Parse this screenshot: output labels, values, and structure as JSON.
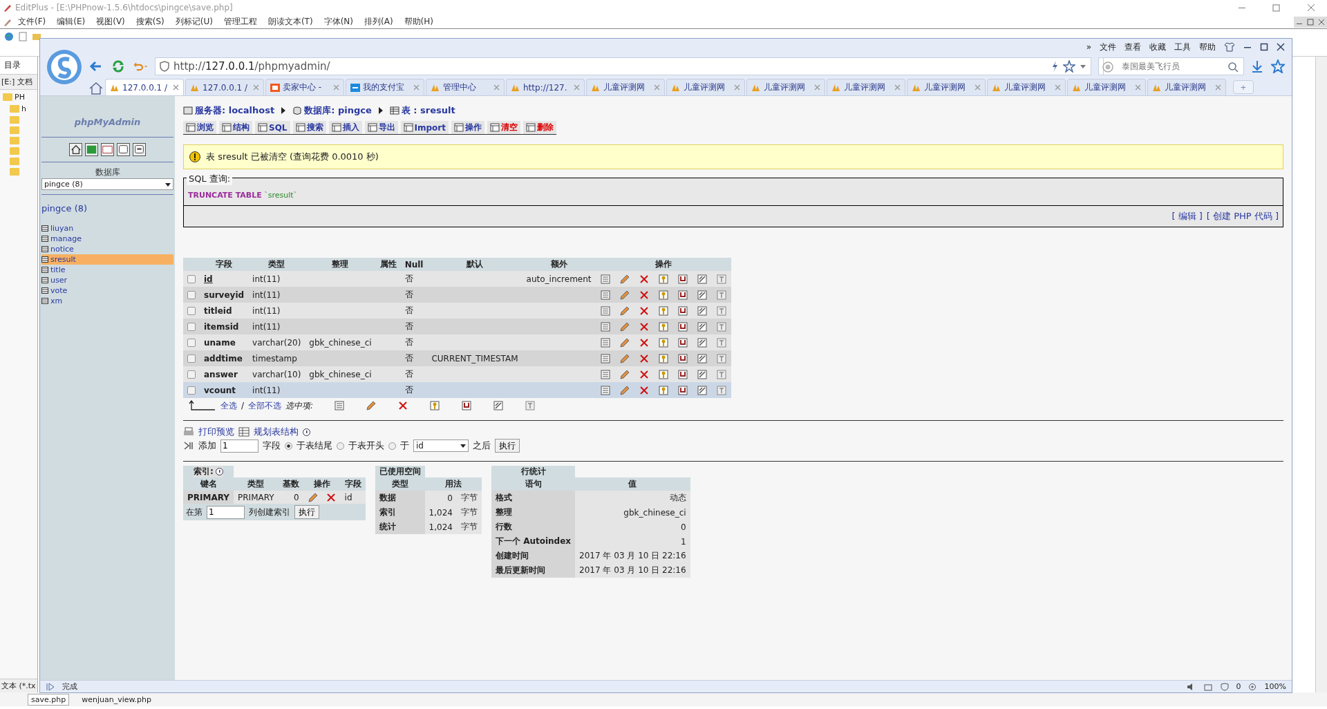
{
  "editor": {
    "title": "EditPlus - [E:\\PHPnow-1.5.6\\htdocs\\pingce\\save.php]",
    "menu": [
      "文件(F)",
      "编辑(E)",
      "视图(V)",
      "搜索(S)",
      "列标记(U)",
      "管理工程",
      "朗读文本(T)",
      "字体(N)",
      "排列(A)",
      "帮助(H)"
    ],
    "sidebar_tab": "目录",
    "drive": "[E:] 文档",
    "folders": [
      "PH",
      "h"
    ],
    "filter": "文本 (*.tx",
    "files": [
      {
        "name": "save.php",
        "selected": true
      },
      {
        "name": "wenjuan_view.php",
        "selected": false
      }
    ]
  },
  "browser": {
    "menu": [
      "»",
      "文件",
      "查看",
      "收藏",
      "工具",
      "帮助"
    ],
    "url": {
      "scheme": "http://",
      "host": "127.0.0.1",
      "path": "/phpmyadmin/"
    },
    "search": {
      "placeholder": "泰国最美飞行员"
    },
    "tabs": [
      {
        "label": "127.0.0.1 /",
        "kind": "pma",
        "selected": true
      },
      {
        "label": "127.0.0.1 /",
        "kind": "pma",
        "selected": false
      },
      {
        "label": "卖家中心 -",
        "kind": "shop",
        "selected": false
      },
      {
        "label": "我的支付宝",
        "kind": "pay",
        "selected": false
      },
      {
        "label": "管理中心",
        "kind": "pma",
        "selected": false
      },
      {
        "label": "http://127.",
        "kind": "pma",
        "selected": false
      },
      {
        "label": "儿童评测网",
        "kind": "pma",
        "selected": false
      },
      {
        "label": "儿童评测网",
        "kind": "pma",
        "selected": false
      },
      {
        "label": "儿童评测网",
        "kind": "pma",
        "selected": false
      },
      {
        "label": "儿童评测网",
        "kind": "pma",
        "selected": false
      },
      {
        "label": "儿童评测网",
        "kind": "pma",
        "selected": false
      },
      {
        "label": "儿童评测网",
        "kind": "pma",
        "selected": false
      },
      {
        "label": "儿童评测网",
        "kind": "pma",
        "selected": false
      },
      {
        "label": "儿童评测网",
        "kind": "pma",
        "selected": false
      }
    ],
    "new_tab": "+",
    "status": "完成",
    "blocked": "0",
    "zoom": "100%"
  },
  "sidebar": {
    "logo": "phpMyAdmin",
    "db_label": "数据库",
    "db_select": "pingce (8)",
    "db_link": "pingce (8)",
    "tables": [
      {
        "name": "liuyan",
        "selected": false
      },
      {
        "name": "manage",
        "selected": false
      },
      {
        "name": "notice",
        "selected": false
      },
      {
        "name": "sresult",
        "selected": true
      },
      {
        "name": "title",
        "selected": false
      },
      {
        "name": "user",
        "selected": false
      },
      {
        "name": "vote",
        "selected": false
      },
      {
        "name": "xm",
        "selected": false
      }
    ]
  },
  "breadcrumb": [
    "服务器: localhost",
    "数据库: pingce",
    "表 : sresult"
  ],
  "tabs": [
    {
      "label": "浏览",
      "kind": "normal"
    },
    {
      "label": "结构",
      "kind": "normal"
    },
    {
      "label": "SQL",
      "kind": "normal"
    },
    {
      "label": "搜索",
      "kind": "normal"
    },
    {
      "label": "插入",
      "kind": "normal"
    },
    {
      "label": "导出",
      "kind": "normal"
    },
    {
      "label": "Import",
      "kind": "normal"
    },
    {
      "label": "操作",
      "kind": "normal"
    },
    {
      "label": "清空",
      "kind": "danger"
    },
    {
      "label": "删除",
      "kind": "danger"
    }
  ],
  "message": "表 sresult 已被清空 (查询花费 0.0010 秒)",
  "sql": {
    "legend": "SQL 查询:",
    "keyword": "TRUNCATE TABLE",
    "name": "`sresult`",
    "links": [
      "[ 编辑 ]",
      "[ 创建 PHP 代码 ]"
    ]
  },
  "structure": {
    "columns": [
      "字段",
      "类型",
      "整理",
      "属性",
      "Null",
      "默认",
      "额外",
      "操作"
    ],
    "rows": [
      {
        "field": "id",
        "type": "int(11)",
        "collation": "",
        "null": "否",
        "default": "",
        "extra": "auto_increment",
        "primary": true,
        "hovered": false
      },
      {
        "field": "surveyid",
        "type": "int(11)",
        "collation": "",
        "null": "否",
        "default": "",
        "extra": "",
        "primary": false,
        "hovered": false
      },
      {
        "field": "titleid",
        "type": "int(11)",
        "collation": "",
        "null": "否",
        "default": "",
        "extra": "",
        "primary": false,
        "hovered": false
      },
      {
        "field": "itemsid",
        "type": "int(11)",
        "collation": "",
        "null": "否",
        "default": "",
        "extra": "",
        "primary": false,
        "hovered": false
      },
      {
        "field": "uname",
        "type": "varchar(20)",
        "collation": "gbk_chinese_ci",
        "null": "否",
        "default": "",
        "extra": "",
        "primary": false,
        "hovered": false
      },
      {
        "field": "addtime",
        "type": "timestamp",
        "collation": "",
        "null": "否",
        "default": "CURRENT_TIMESTAM",
        "extra": "",
        "primary": false,
        "hovered": false
      },
      {
        "field": "answer",
        "type": "varchar(10)",
        "collation": "gbk_chinese_ci",
        "null": "否",
        "default": "",
        "extra": "",
        "primary": false,
        "hovered": false
      },
      {
        "field": "vcount",
        "type": "int(11)",
        "collation": "",
        "null": "否",
        "default": "",
        "extra": "",
        "primary": false,
        "hovered": true
      }
    ],
    "check_all": "全选",
    "separator": "/",
    "uncheck_all": "全部不选",
    "with_selected": "选中项:"
  },
  "tools": {
    "print": "打印预览",
    "plan": "规划表结构",
    "add": "添加",
    "count": "1",
    "fields": "字段",
    "positions": [
      {
        "label": "于表结尾",
        "selected": true
      },
      {
        "label": "于表开头",
        "selected": false
      },
      {
        "label": "于",
        "selected": false
      }
    ],
    "after_field": "id",
    "after": "之后",
    "go": "执行"
  },
  "indexes": {
    "title": "索引:",
    "columns": [
      "键名",
      "类型",
      "基数",
      "操作",
      "字段"
    ],
    "rows": [
      {
        "key": "PRIMARY",
        "type": "PRIMARY",
        "cardinality": "0",
        "field": "id"
      }
    ],
    "create_prefix": "在第",
    "create_count": "1",
    "create_suffix": "列创建索引",
    "go": "执行"
  },
  "space": {
    "title": "已使用空间",
    "type_header": "类型",
    "usage_header": "用法",
    "items": [
      {
        "label": "数据",
        "amount": "0",
        "unit": "字节"
      },
      {
        "label": "索引",
        "amount": "1,024",
        "unit": "字节"
      },
      {
        "label": "统计",
        "amount": "1,024",
        "unit": "字节"
      }
    ]
  },
  "row_stats": {
    "title": "行统计",
    "columns": [
      "语句",
      "值"
    ],
    "rows": [
      [
        "格式",
        "动态"
      ],
      [
        "整理",
        "gbk_chinese_ci"
      ],
      [
        "行数",
        "0"
      ],
      [
        "下一个 Autoindex",
        "1"
      ],
      [
        "创建时间",
        "2017 年 03 月 10 日 22:16"
      ],
      [
        "最后更新时间",
        "2017 年 03 月 10 日 22:16"
      ]
    ]
  }
}
